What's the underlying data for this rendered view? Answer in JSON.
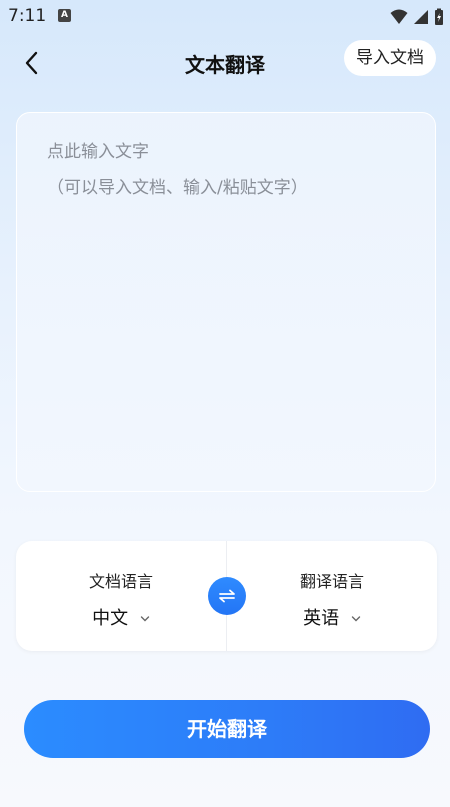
{
  "status_bar": {
    "time": "7:11",
    "notification_glyph": "A"
  },
  "header": {
    "title": "文本翻译",
    "import_label": "导入文档"
  },
  "input": {
    "placeholder": "点此输入文字",
    "hint": "（可以导入文档、输入/粘贴文字）"
  },
  "languages": {
    "source_label": "文档语言",
    "source_value": "中文",
    "target_label": "翻译语言",
    "target_value": "英语"
  },
  "actions": {
    "start_label": "开始翻译"
  },
  "colors": {
    "accent": "#2d7cf8",
    "accent_light": "#2b8cff",
    "placeholder": "#8a8f98"
  },
  "icons": {
    "back": "back-arrow-icon",
    "swap": "swap-icon",
    "chevron": "chevron-down-icon"
  }
}
